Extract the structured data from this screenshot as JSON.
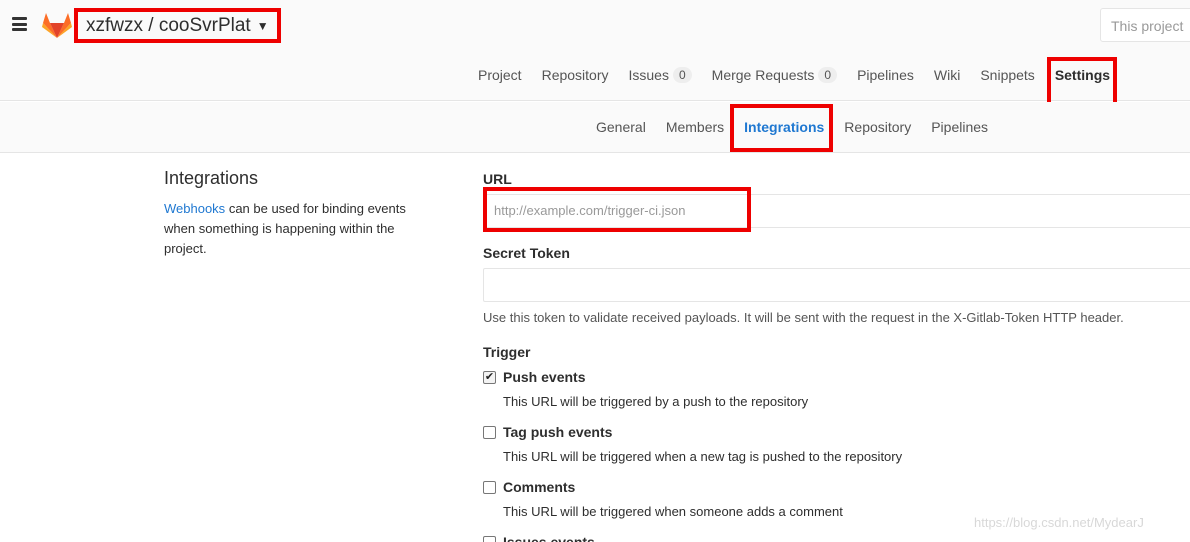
{
  "header": {
    "project_path": "xzfwzx / cooSvrPlat",
    "search_placeholder": "This project"
  },
  "main_nav": {
    "project": "Project",
    "repository": "Repository",
    "issues": "Issues",
    "issues_count": "0",
    "merge_requests": "Merge Requests",
    "merge_requests_count": "0",
    "pipelines": "Pipelines",
    "wiki": "Wiki",
    "snippets": "Snippets",
    "settings": "Settings"
  },
  "sub_nav": {
    "general": "General",
    "members": "Members",
    "integrations": "Integrations",
    "repository": "Repository",
    "pipelines": "Pipelines"
  },
  "intro": {
    "title": "Integrations",
    "link": "Webhooks",
    "text": "can be used for binding events when something is happening within the project."
  },
  "form": {
    "url_label": "URL",
    "url_placeholder": "http://example.com/trigger-ci.json",
    "secret_label": "Secret Token",
    "secret_value": "",
    "secret_help": "Use this token to validate received payloads. It will be sent with the request in the X-Gitlab-Token HTTP header.",
    "trigger_label": "Trigger"
  },
  "events": [
    {
      "title": "Push events",
      "desc": "This URL will be triggered by a push to the repository",
      "checked": true
    },
    {
      "title": "Tag push events",
      "desc": "This URL will be triggered when a new tag is pushed to the repository",
      "checked": false
    },
    {
      "title": "Comments",
      "desc": "This URL will be triggered when someone adds a comment",
      "checked": false
    },
    {
      "title": "Issues events",
      "desc": "",
      "checked": false
    }
  ],
  "watermark": "https://blog.csdn.net/MydearJ",
  "colors": {
    "accent": "#1f78d1",
    "highlight_box": "#ee0000",
    "logo": "#e24329"
  }
}
